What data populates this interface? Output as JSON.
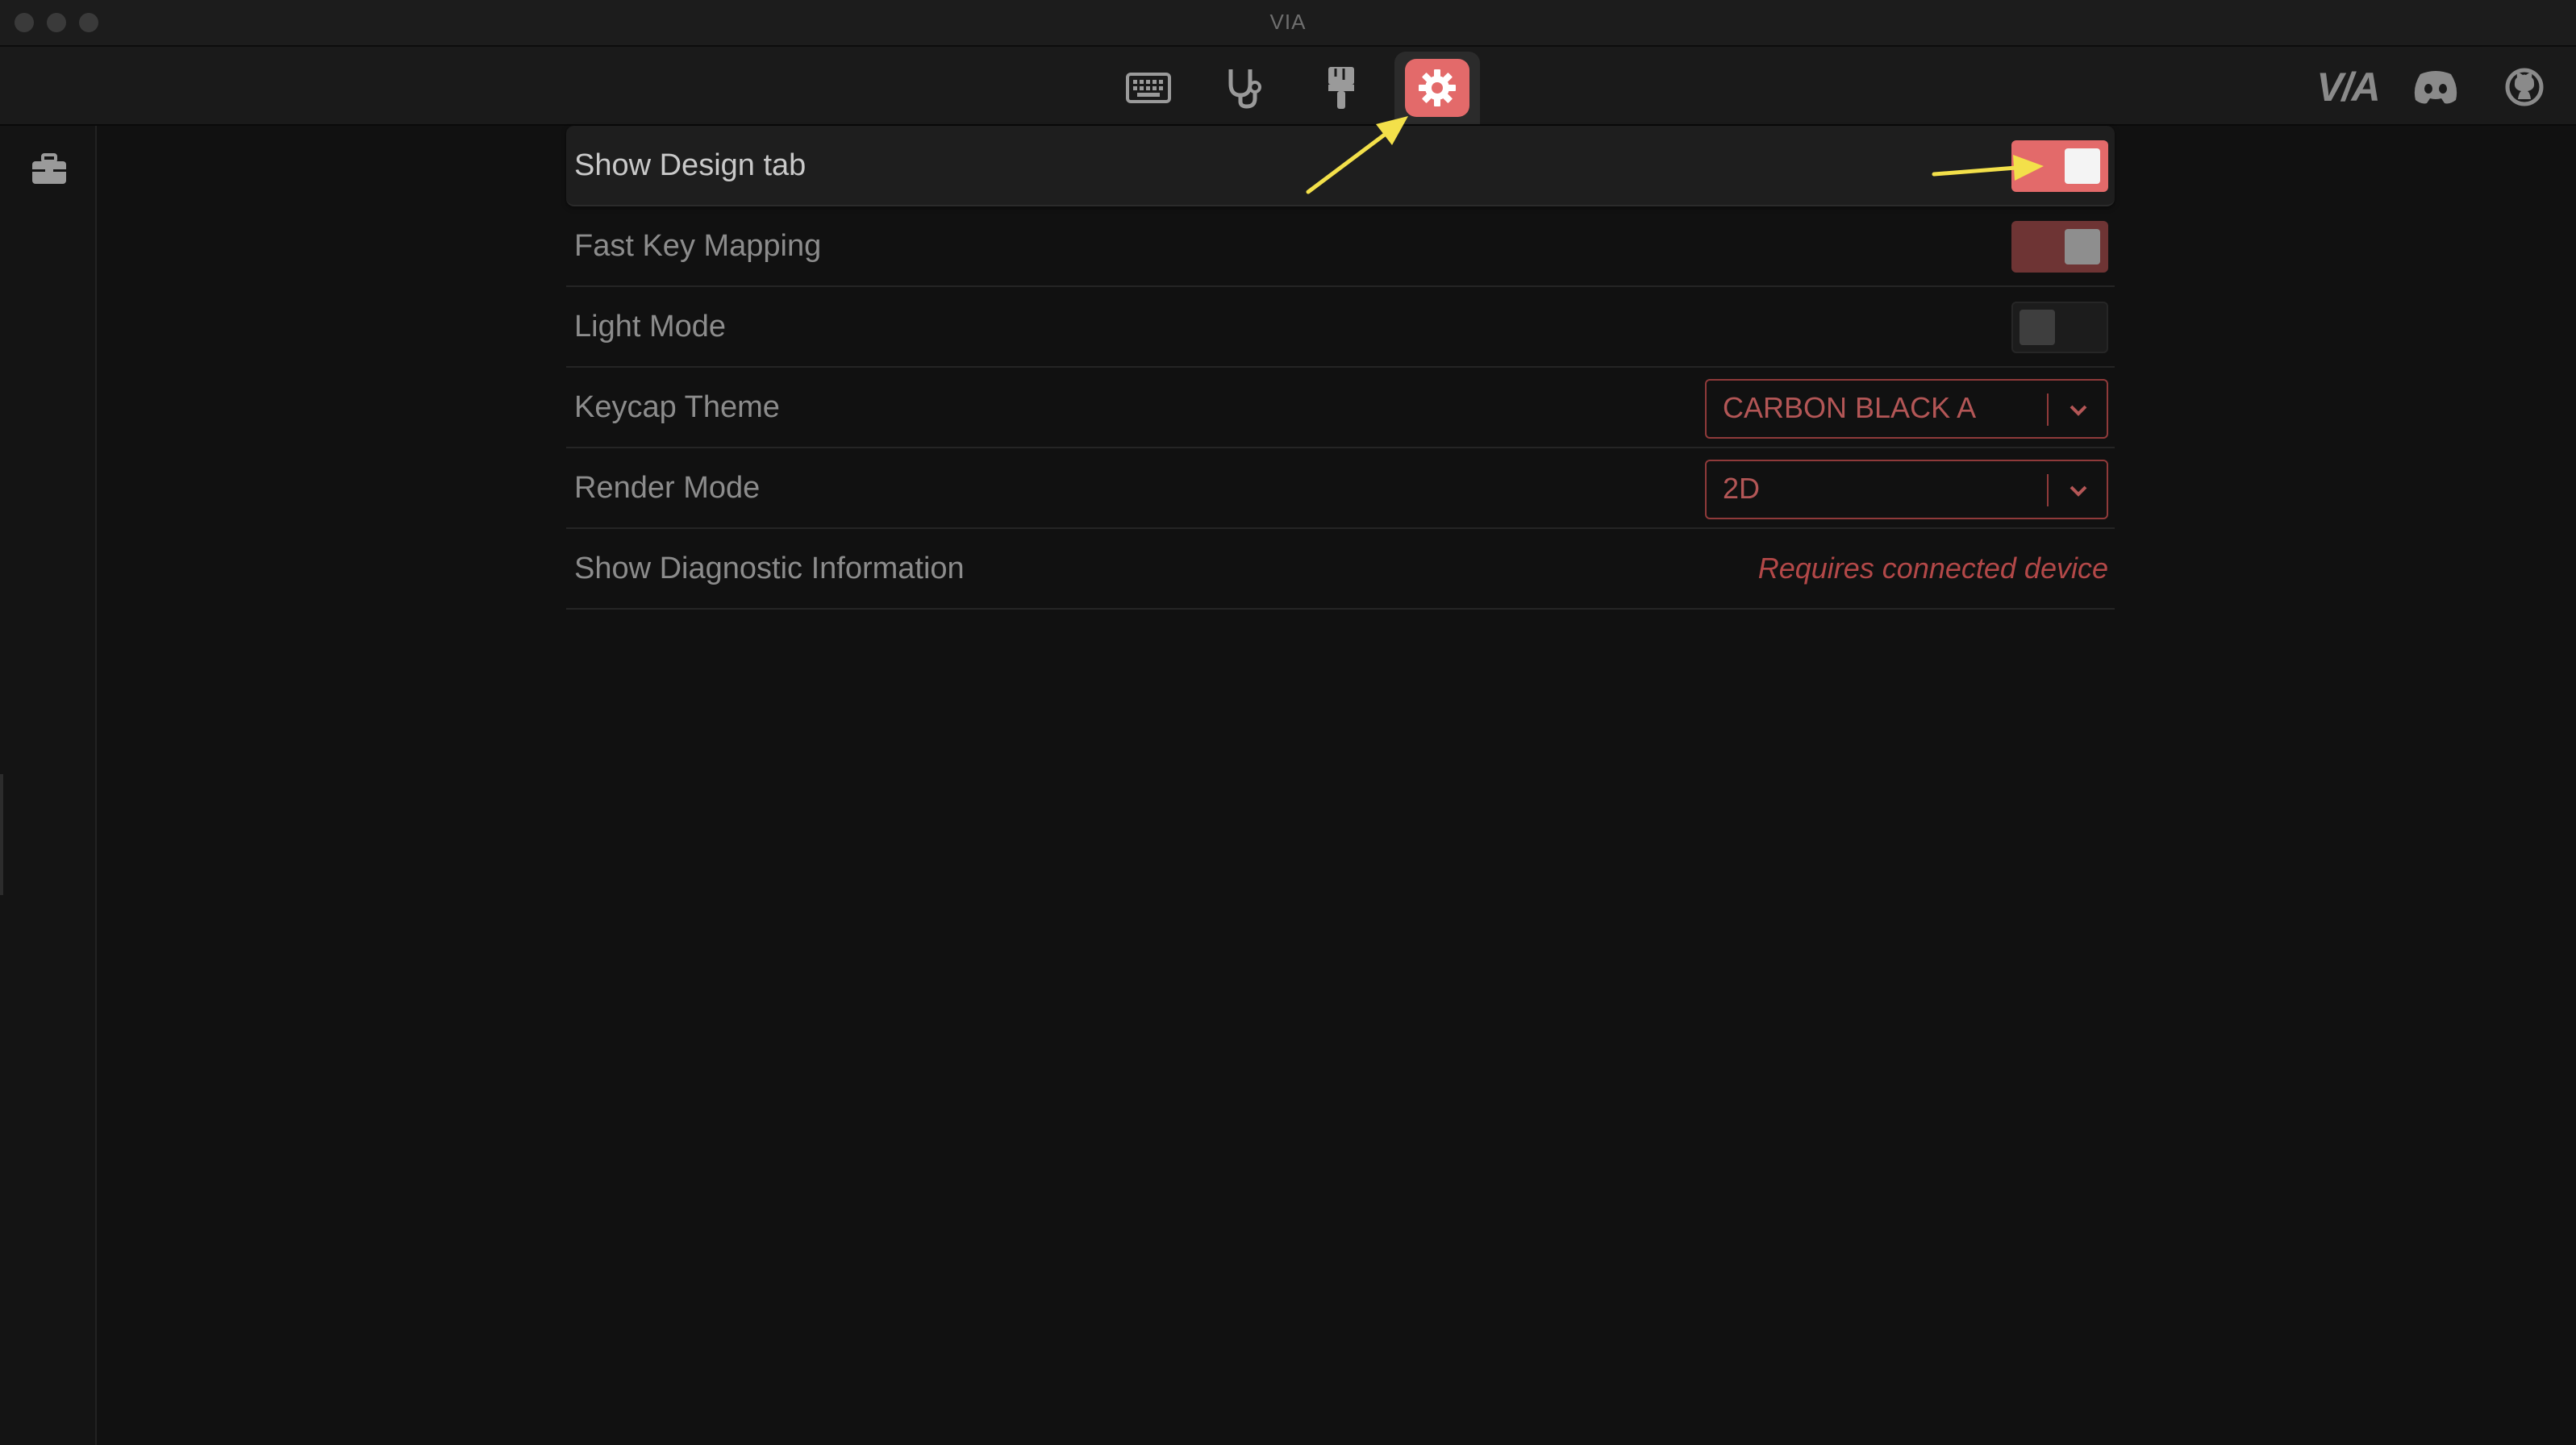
{
  "window": {
    "title": "VIA"
  },
  "toolbar": {
    "tabs": [
      {
        "name": "configure",
        "icon": "keyboard-icon"
      },
      {
        "name": "test",
        "icon": "stethoscope-icon"
      },
      {
        "name": "design",
        "icon": "paintbrush-icon"
      },
      {
        "name": "settings",
        "icon": "gear-icon",
        "active": true
      }
    ],
    "right": {
      "logo_text": "V/A",
      "discord_icon": "discord-icon",
      "github_icon": "github-icon"
    }
  },
  "sidebar": {
    "icon": "toolbox-icon"
  },
  "settings": {
    "rows": [
      {
        "label": "Show Design tab",
        "control": "toggle",
        "state": "on"
      },
      {
        "label": "Fast Key Mapping",
        "control": "toggle",
        "state": "on"
      },
      {
        "label": "Light Mode",
        "control": "toggle",
        "state": "off"
      },
      {
        "label": "Keycap Theme",
        "control": "select",
        "value": "CARBON BLACK A"
      },
      {
        "label": "Render Mode",
        "control": "select",
        "value": "2D"
      },
      {
        "label": "Show Diagnostic Information",
        "control": "status",
        "value": "Requires connected device"
      }
    ]
  },
  "colors": {
    "accent": "#e36a6a",
    "accent_dim": "#6e3434",
    "select_border": "#8f3a3a",
    "select_text": "#b35656",
    "status_text": "#b34848",
    "annotation_arrow": "#f3e04a",
    "background": "#111111"
  }
}
